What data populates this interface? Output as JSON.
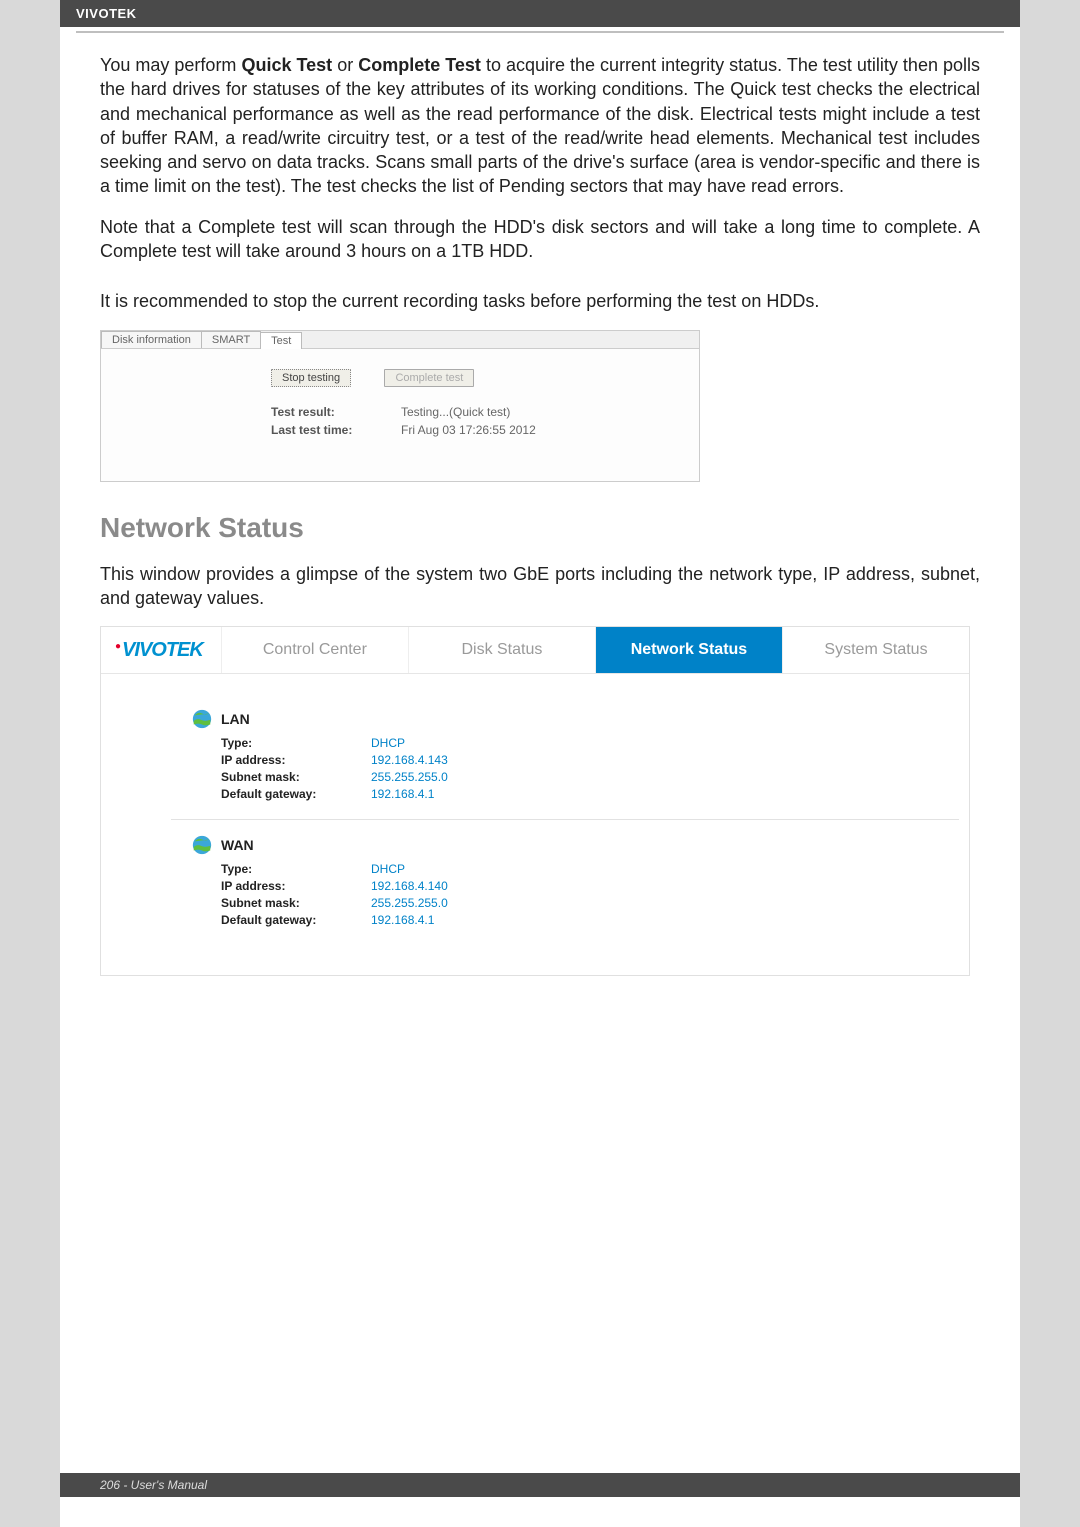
{
  "header": {
    "brand": "VIVOTEK"
  },
  "body": {
    "p1_pre": "You may perform ",
    "p1_b1": "Quick Test",
    "p1_mid": " or ",
    "p1_b2": "Complete Test",
    "p1_post": " to acquire the current integrity status. The test utility then polls the hard drives for statuses of the key attributes of its working conditions. The Quick test checks the electrical and mechanical performance as well as the read performance of the disk. Electrical tests might include a test of buffer RAM, a read/write circuitry test, or a test of the read/write head elements. Mechanical test includes seeking and servo on data tracks. Scans small parts of the drive's surface (area is vendor-specific and there is a time limit on the test). The test checks the list of Pending sectors that may have read errors.",
    "p2": "Note that a Complete test will scan through the HDD's disk sectors and will take a long time to complete. A Complete test will take around 3 hours on a 1TB HDD.",
    "p3": "It is recommended to stop the current recording tasks before performing the test on HDDs."
  },
  "test_panel": {
    "tabs": {
      "t1": "Disk information",
      "t2": "SMART",
      "t3": "Test"
    },
    "btn_stop": "Stop testing",
    "btn_complete": "Complete test",
    "result_label": "Test result:",
    "result_value": "Testing...(Quick test)",
    "time_label": "Last test time:",
    "time_value": "Fri Aug 03 17:26:55 2012"
  },
  "section2": {
    "heading": "Network Status",
    "intro": "This window provides a glimpse of the system two GbE ports including the network type, IP address, subnet, and gateway values."
  },
  "net_panel": {
    "logo_text": "VIVOTEK",
    "tabs": {
      "control": "Control Center",
      "disk": "Disk Status",
      "network": "Network Status",
      "system": "System Status"
    },
    "lan": {
      "title": "LAN",
      "type_label": "Type:",
      "type_value": "DHCP",
      "ip_label": "IP address:",
      "ip_value": "192.168.4.143",
      "mask_label": "Subnet mask:",
      "mask_value": "255.255.255.0",
      "gw_label": "Default gateway:",
      "gw_value": "192.168.4.1"
    },
    "wan": {
      "title": "WAN",
      "type_label": "Type:",
      "type_value": "DHCP",
      "ip_label": "IP address:",
      "ip_value": "192.168.4.140",
      "mask_label": "Subnet mask:",
      "mask_value": "255.255.255.0",
      "gw_label": "Default gateway:",
      "gw_value": "192.168.4.1"
    }
  },
  "footer": {
    "text": "206 - User's Manual"
  }
}
